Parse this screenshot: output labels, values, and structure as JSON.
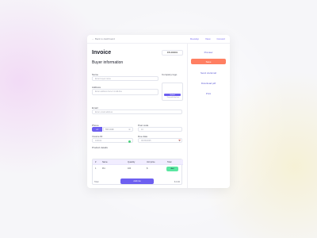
{
  "topbar": {
    "back": "← Back to dashboard",
    "actions": [
      "Develop",
      "View",
      "Convert"
    ]
  },
  "page": {
    "title": "Invoice",
    "invoice_number": "INV-000001",
    "section": "Buyer information"
  },
  "form": {
    "name_label": "Name",
    "name_placeholder": "Enter buyer name",
    "address_label": "Address",
    "address_placeholder": "Enter address here it multi-line",
    "email_label": "Email",
    "email_placeholder": "Enter email address",
    "phone_label": "Phone",
    "phone_prefix": "+1",
    "phone_value": "555 0198",
    "post_code_label": "Post code",
    "post_code_value": "10",
    "invoice_id_label": "Invoice ID",
    "invoice_id_value": "100011",
    "due_date_label": "Due date",
    "due_date_value": "06/30/2025",
    "company_logo_label": "Company logo",
    "company_logo_button": "Upload",
    "company_logo_hint": "Drag and drop here"
  },
  "products": {
    "title": "Product details",
    "headers": [
      "#",
      "Name",
      "Quantity",
      "Unit price",
      "Total"
    ],
    "row": [
      "1",
      "Pro",
      "100",
      "$",
      "Add"
    ],
    "add_row": "Add row"
  },
  "footer": {
    "left": "Total",
    "right": "$ 0.00"
  },
  "sidebar": {
    "items": [
      "Preview",
      "Save",
      "Send via Email",
      "Download pdf",
      "Print"
    ]
  }
}
